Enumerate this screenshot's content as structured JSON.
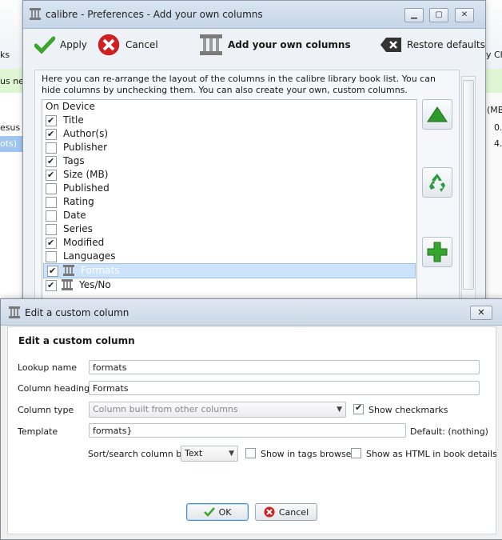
{
  "background": {
    "toolbar_fragment": "ks",
    "strip_fragment": "us ne",
    "row1_fragment": "esus N",
    "row2_fragment": "ots)",
    "right_col_header": "(MB",
    "right_val1": "0.",
    "right_val2": "4.",
    "right_toolbar": "y Ch"
  },
  "prefs": {
    "title": "calibre - Preferences - Add your own columns",
    "toolbar": {
      "apply": "Apply",
      "cancel": "Cancel",
      "section": "Add your own columns",
      "restore": "Restore defaults"
    },
    "description": "Here you can re-arrange the layout of the columns in the calibre library book list. You can hide columns by unchecking them. You can also create your own, custom columns.",
    "columns": [
      {
        "label": "On Device",
        "checked": null
      },
      {
        "label": "Title",
        "checked": true
      },
      {
        "label": "Author(s)",
        "checked": true
      },
      {
        "label": "Publisher",
        "checked": false
      },
      {
        "label": "Tags",
        "checked": true
      },
      {
        "label": "Size (MB)",
        "checked": true
      },
      {
        "label": "Published",
        "checked": false
      },
      {
        "label": "Rating",
        "checked": false
      },
      {
        "label": "Date",
        "checked": false
      },
      {
        "label": "Series",
        "checked": false
      },
      {
        "label": "Modified",
        "checked": true
      },
      {
        "label": "Languages",
        "checked": false
      },
      {
        "label": "Formats",
        "checked": true,
        "custom": true,
        "selected": true
      },
      {
        "label": "Yes/No",
        "checked": true,
        "custom": true
      }
    ]
  },
  "dialog": {
    "title": "Edit a custom column",
    "heading": "Edit a custom column",
    "lookup_label": "Lookup name",
    "lookup_value": "formats",
    "heading_label": "Column heading",
    "heading_value": "Formats",
    "type_label": "Column type",
    "type_value": "Column built from other columns",
    "show_checkmarks": "Show checkmarks",
    "template_label": "Template",
    "template_value": "formats}",
    "default_text": "Default: (nothing)",
    "sort_label": "Sort/search column by",
    "sort_value": "Text",
    "show_tags": "Show in tags browser",
    "show_html": "Show as HTML in book details",
    "ok": "OK",
    "cancel": "Cancel"
  },
  "colors": {
    "accent": "#3d8ee0",
    "selection": "#cde3fb",
    "green_strip": "#dff6d4"
  }
}
